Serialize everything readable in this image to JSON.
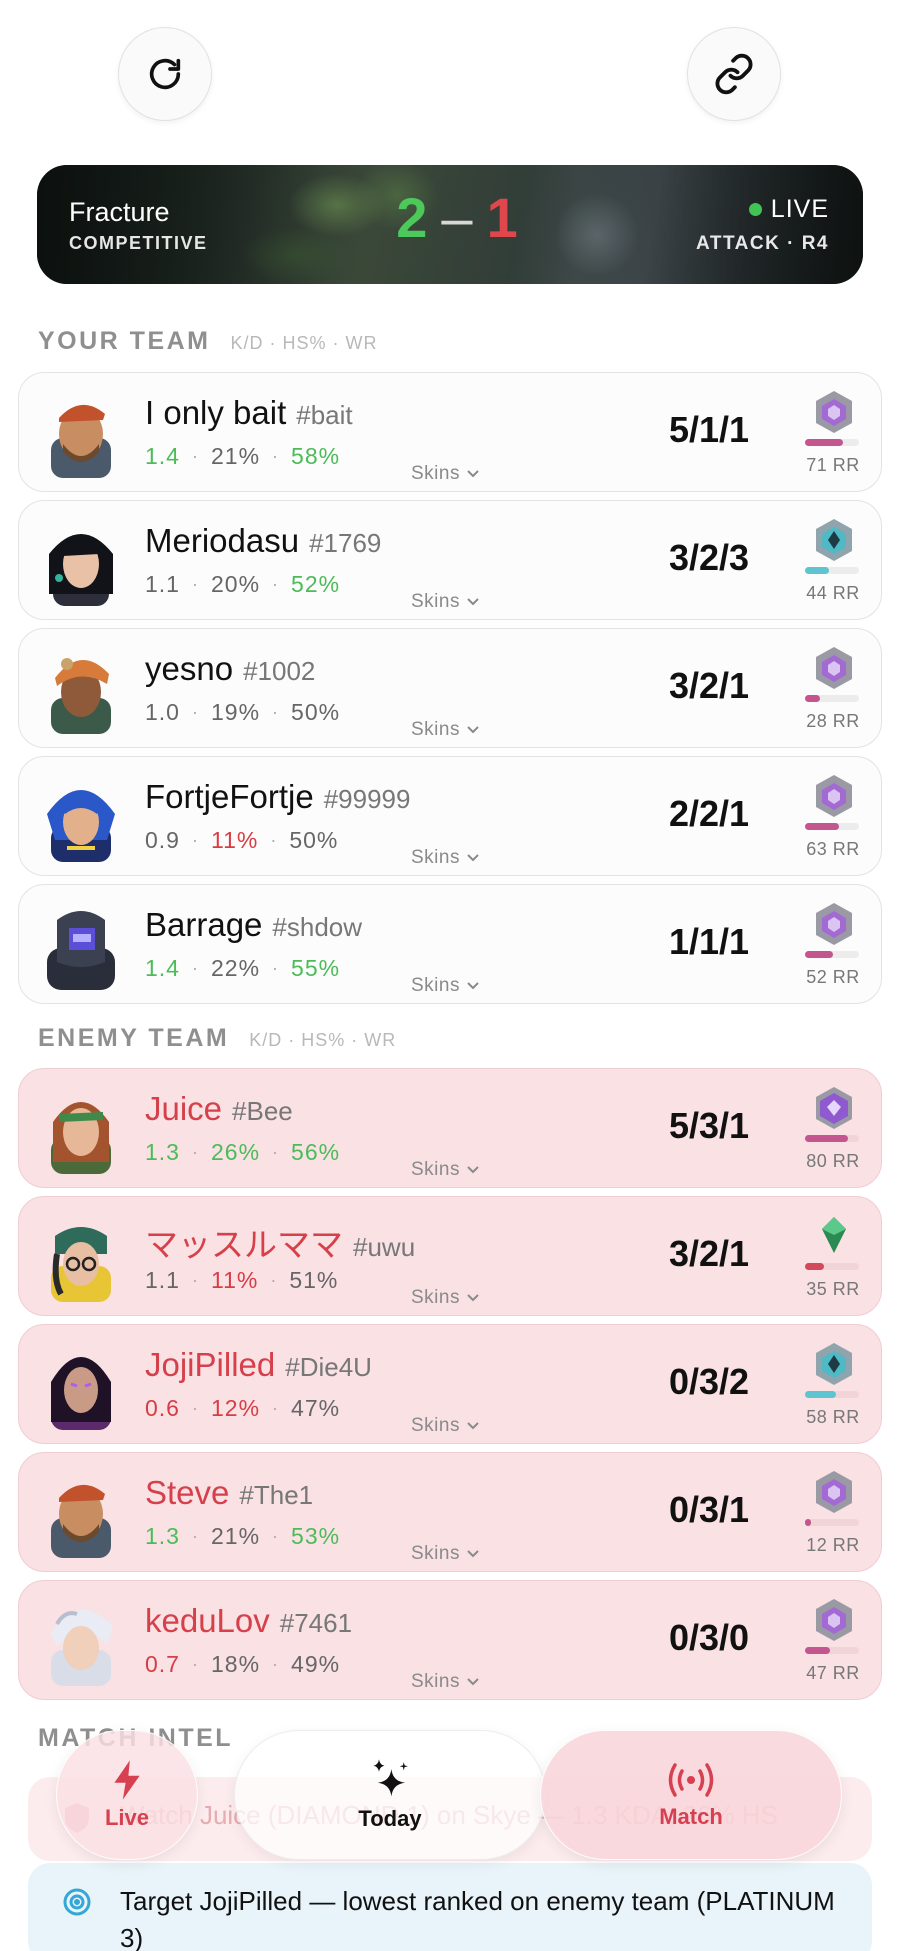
{
  "match": {
    "map": "Fracture",
    "mode": "COMPETITIVE",
    "score_ally": "2",
    "score_sep": "–",
    "score_enemy": "1",
    "status": "LIVE",
    "round_info": "ATTACK · R4"
  },
  "your_team": {
    "title": "YOUR TEAM",
    "subtitle": "K/D · HS% · WR",
    "players": [
      {
        "name": "I only bait",
        "tag": "#bait",
        "kd": "1.4",
        "hs": "21%",
        "wr": "58%",
        "kda": "5/1/1",
        "rr": "71 RR",
        "skins": "Skins",
        "rr_fraction": 0.71
      },
      {
        "name": "Meriodasu",
        "tag": "#1769",
        "kd": "1.1",
        "hs": "20%",
        "wr": "52%",
        "kda": "3/2/3",
        "rr": "44 RR",
        "skins": "Skins",
        "rr_fraction": 0.44
      },
      {
        "name": "yesno",
        "tag": "#1002",
        "kd": "1.0",
        "hs": "19%",
        "wr": "50%",
        "kda": "3/2/1",
        "rr": "28 RR",
        "skins": "Skins",
        "rr_fraction": 0.28
      },
      {
        "name": "FortjeFortje",
        "tag": "#99999",
        "kd": "0.9",
        "hs": "11%",
        "wr": "50%",
        "kda": "2/2/1",
        "rr": "63 RR",
        "skins": "Skins",
        "rr_fraction": 0.63
      },
      {
        "name": "Barrage",
        "tag": "#shdow",
        "kd": "1.4",
        "hs": "22%",
        "wr": "55%",
        "kda": "1/1/1",
        "rr": "52 RR",
        "skins": "Skins",
        "rr_fraction": 0.52
      }
    ]
  },
  "enemy_team": {
    "title": "ENEMY TEAM",
    "subtitle": "K/D · HS% · WR",
    "players": [
      {
        "name": "Juice",
        "tag": "#Bee",
        "kd": "1.3",
        "hs": "26%",
        "wr": "56%",
        "kda": "5/3/1",
        "rr": "80 RR",
        "skins": "Skins",
        "rr_fraction": 0.8
      },
      {
        "name": "マッスルママ",
        "tag": "#uwu",
        "kd": "1.1",
        "hs": "11%",
        "wr": "51%",
        "kda": "3/2/1",
        "rr": "35 RR",
        "skins": "Skins",
        "rr_fraction": 0.35
      },
      {
        "name": "JojiPilled",
        "tag": "#Die4U",
        "kd": "0.6",
        "hs": "12%",
        "wr": "47%",
        "kda": "0/3/2",
        "rr": "58 RR",
        "skins": "Skins",
        "rr_fraction": 0.58
      },
      {
        "name": "Steve",
        "tag": "#The1",
        "kd": "1.3",
        "hs": "21%",
        "wr": "53%",
        "kda": "0/3/1",
        "rr": "12 RR",
        "skins": "Skins",
        "rr_fraction": 0.12
      },
      {
        "name": "keduLov",
        "tag": "#7461",
        "kd": "0.7",
        "hs": "18%",
        "wr": "49%",
        "kda": "0/3/0",
        "rr": "47 RR",
        "skins": "Skins",
        "rr_fraction": 0.47
      }
    ]
  },
  "intel": {
    "title": "MATCH INTEL",
    "warning": "Watch Juice (DIAMOND 1) on Skye — 1.3 KDA, 26% HS",
    "tip": "Target JojiPilled — lowest ranked on enemy team (PLATINUM 3)"
  },
  "tabs": {
    "live": "Live",
    "today": "Today",
    "match": "Match"
  },
  "colors": {
    "stat_good": "#4cbb58",
    "stat_bad": "#d83c44",
    "enemy_name": "#d6404b",
    "rank_platinum": "#c3568f",
    "rank_ascendant": "#d1495b",
    "rank_diamond": "#5ec4cf"
  },
  "icons": {
    "refresh": "refresh-icon",
    "link": "link-icon",
    "live_tab": "lightning-icon",
    "today_tab": "sparkles-icon",
    "match_tab": "broadcast-icon",
    "tip": "target-icon",
    "warning": "shield-icon"
  }
}
